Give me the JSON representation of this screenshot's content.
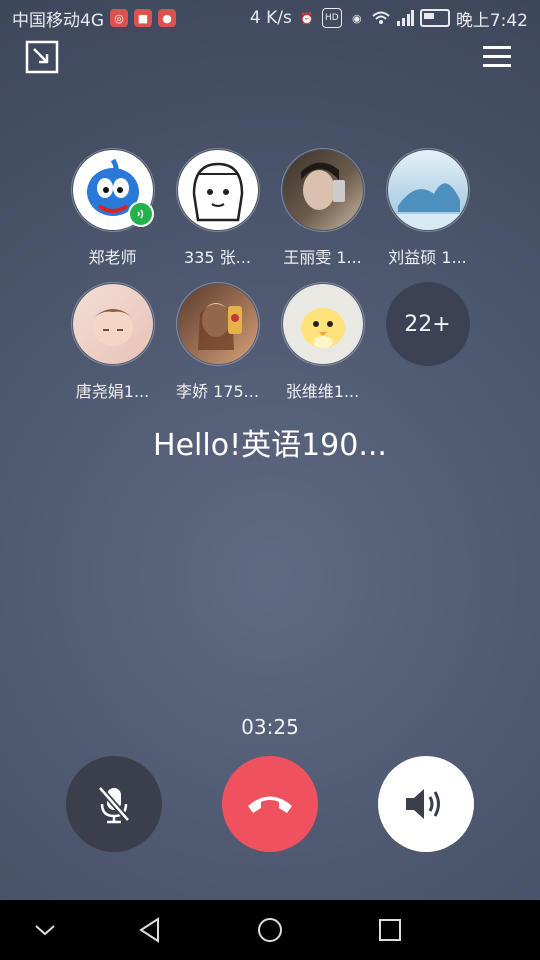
{
  "status_bar": {
    "carrier": "中国移动4G",
    "speed": "4 K/s",
    "time": "晚上7:42",
    "icons": [
      "app-notification-icon",
      "app-notification-icon",
      "map-pin-icon",
      "alarm-icon",
      "hd-icon",
      "eye-icon",
      "wifi-icon",
      "signal-icon",
      "battery-icon"
    ]
  },
  "toolbar": {
    "minimize_icon": "minimize-window-icon",
    "menu_icon": "hamburger-menu-icon"
  },
  "participants": [
    {
      "name": "郑老师",
      "speaking": true
    },
    {
      "name": "335  张..."
    },
    {
      "name": "王丽雯 1..."
    },
    {
      "name": "刘益硕 1..."
    },
    {
      "name": "唐尧娟1..."
    },
    {
      "name": "李娇 175..."
    },
    {
      "name": "张维维1..."
    }
  ],
  "more_participants": "22+",
  "group_name": "Hello!英语190...",
  "call_timer": "03:25",
  "controls": {
    "mute_icon": "microphone-muted-icon",
    "hangup_icon": "phone-hangup-icon",
    "speaker_icon": "speaker-icon"
  },
  "navigation": [
    "chevron-down-icon",
    "back-icon",
    "home-icon",
    "recents-icon"
  ],
  "colors": {
    "hangup": "#f0515e",
    "speaking_badge": "#22b14c"
  }
}
